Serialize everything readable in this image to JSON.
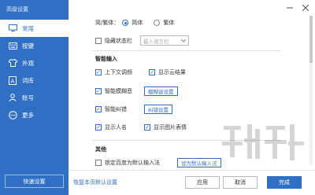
{
  "window": {
    "title": "高级设置"
  },
  "sidebar": {
    "items": [
      {
        "label": "常用",
        "icon": "monitor-icon",
        "active": true
      },
      {
        "label": "按键",
        "icon": "keyboard-icon",
        "active": false
      },
      {
        "label": "外观",
        "icon": "shirt-icon",
        "active": false
      },
      {
        "label": "词库",
        "icon": "dictionary-icon",
        "active": false
      },
      {
        "label": "账号",
        "icon": "user-icon",
        "active": false
      },
      {
        "label": "更多",
        "icon": "more-icon",
        "active": false
      }
    ],
    "quick_settings": "快速设置"
  },
  "general": {
    "script_label": "简/繁体：",
    "options": [
      {
        "label": "简体",
        "selected": true
      },
      {
        "label": "繁体",
        "selected": false
      }
    ],
    "hide_status_bar": {
      "label": "隐藏状态栏",
      "checked": false
    },
    "language_select": {
      "placeholder": "最入语言栏"
    }
  },
  "smart_input": {
    "section_title": "智能输入",
    "items": [
      {
        "label": "上下文调频",
        "checked": true
      },
      {
        "label": "显示云结果",
        "checked": true
      },
      {
        "label": "智能模糊音",
        "checked": true,
        "button": "模糊音设置"
      },
      {
        "label": "智能纠错",
        "checked": true,
        "button": "纠错设置"
      },
      {
        "label": "显示人名",
        "checked": true
      },
      {
        "label": "显示图片表情",
        "checked": true
      }
    ]
  },
  "other": {
    "section_title": "其他",
    "lock_default": {
      "label": "锁定百度为默认输入法",
      "checked": false,
      "button": "设为默认输入法"
    }
  },
  "footer": {
    "reset": "恢复本页默认设置",
    "apply": "应用",
    "cancel": "取消",
    "done": "完成"
  },
  "colors": {
    "accent": "#2f6fc4"
  }
}
